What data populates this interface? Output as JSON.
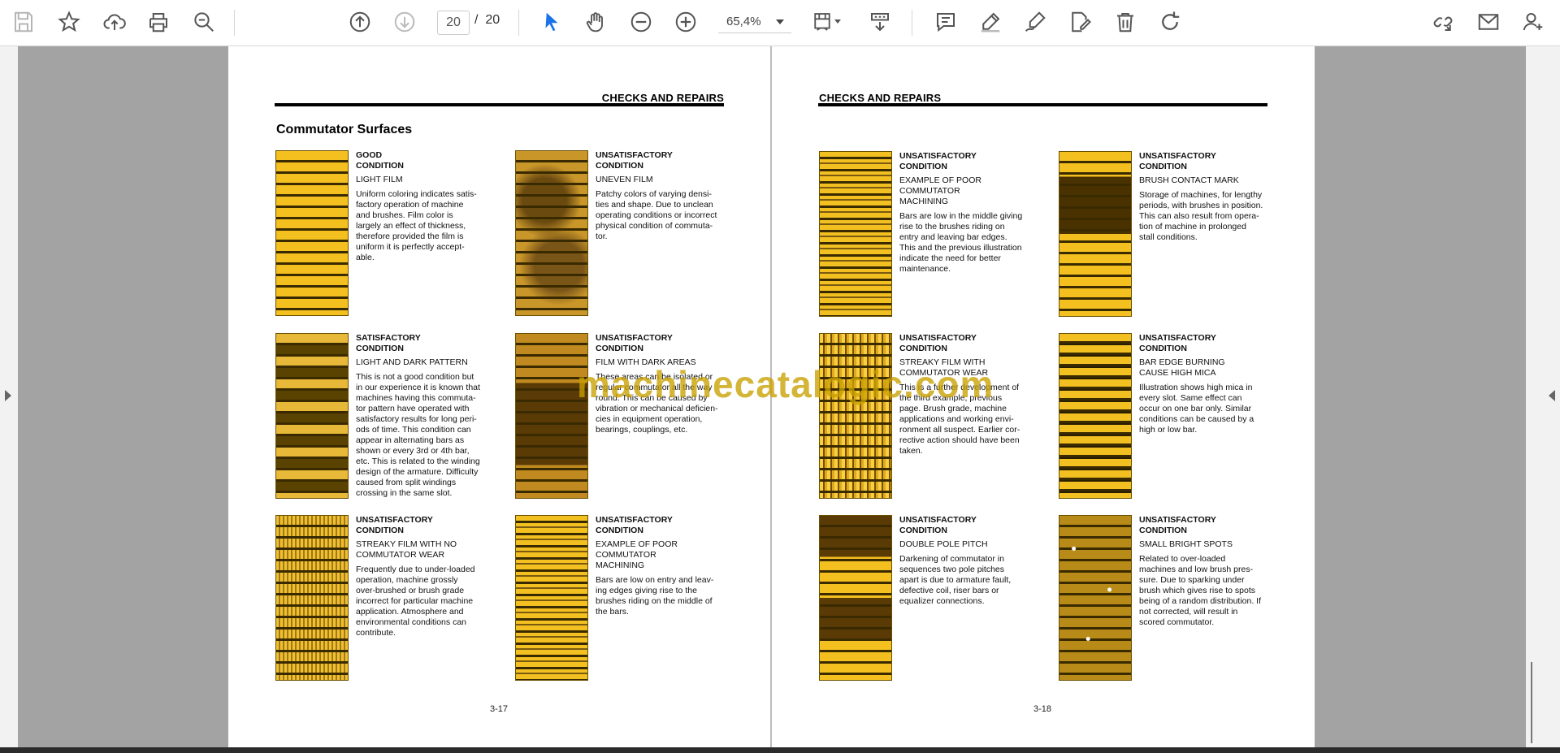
{
  "toolbar": {
    "page_current": "20",
    "page_separator": "/",
    "page_total": "20",
    "zoom": "65,4%",
    "icons": [
      "save-icon",
      "bookmark-star-icon",
      "cloud-upload-icon",
      "print-icon",
      "zoom-search-icon",
      "page-up-icon",
      "page-down-icon",
      "select-arrow-icon",
      "hand-tool-icon",
      "zoom-out-icon",
      "zoom-in-icon",
      "fit-page-icon",
      "scroll-mode-icon",
      "comment-icon",
      "highlight-pen-icon",
      "sign-pen-icon",
      "edit-document-icon",
      "delete-icon",
      "rotate-icon",
      "share-link-icon",
      "email-icon",
      "add-user-icon"
    ]
  },
  "left_page": {
    "header": "CHECKS AND REPAIRS",
    "title": "Commutator Surfaces",
    "page_number": "3-17",
    "entries": [
      {
        "condition": "GOOD\nCONDITION",
        "subtitle": "LIGHT FILM",
        "description": "Uniform coloring indicates satis-\nfactory operation of machine\nand brushes. Film color is\nlargely an effect of thickness,\ntherefore provided the film is\nuniform it is perfectly accept-\nable."
      },
      {
        "condition": "UNSATISFACTORY\nCONDITION",
        "subtitle": "UNEVEN FILM",
        "description": "Patchy colors of varying densi-\nties and shape. Due to unclean\noperating conditions or incorrect\nphysical condition of commuta-\ntor."
      },
      {
        "condition": "SATISFACTORY\nCONDITION",
        "subtitle": "LIGHT AND DARK PATTERN",
        "description": "This is not a good condition but\nin our experience it is known that\nmachines having this commuta-\ntor pattern have operated with\nsatisfactory results for long peri-\nods of time. This condition can\nappear in alternating bars as\nshown or every 3rd or 4th bar,\netc. This is related to the winding\ndesign of the armature. Difficulty\ncaused from split windings\ncrossing in the same slot."
      },
      {
        "condition": "UNSATISFACTORY\nCONDITION",
        "subtitle": "FILM WITH DARK AREAS",
        "description": "These areas can be isolated or\nregular commutator all the way\nround. This can be caused by\nvibration or mechanical deficien-\ncies in equipment operation,\nbearings, couplings, etc."
      },
      {
        "condition": "UNSATISFACTORY\nCONDITION",
        "subtitle": "STREAKY FILM WITH NO\nCOMMUTATOR WEAR",
        "description": "Frequently due to under-loaded\noperation, machine grossly\nover-brushed or brush grade\nincorrect for particular machine\napplication. Atmosphere and\nenvironmental conditions can\ncontribute."
      },
      {
        "condition": "UNSATISFACTORY\nCONDITION",
        "subtitle": "EXAMPLE OF POOR\nCOMMUTATOR\nMACHINING",
        "description": "Bars are low on entry and leav-\ning edges giving rise to the\nbrushes riding on the middle of\nthe bars."
      }
    ]
  },
  "right_page": {
    "header": "CHECKS AND REPAIRS",
    "page_number": "3-18",
    "entries": [
      {
        "condition": "UNSATISFACTORY\nCONDITION",
        "subtitle": "EXAMPLE OF POOR\nCOMMUTATOR\nMACHINING",
        "description": "Bars are low in the middle giving\nrise to the brushes riding on\nentry and leaving bar edges.\nThis and the previous illustration\nindicate the need for better\nmaintenance."
      },
      {
        "condition": "UNSATISFACTORY\nCONDITION",
        "subtitle": "BRUSH CONTACT MARK",
        "description": "Storage of machines, for lengthy\nperiods, with brushes in position.\nThis can also result from opera-\ntion of machine in prolonged\nstall conditions."
      },
      {
        "condition": "UNSATISFACTORY\nCONDITION",
        "subtitle": "STREAKY FILM WITH\nCOMMUTATOR WEAR",
        "description": "This is a further development of\nthe third example, previous\npage. Brush grade, machine\napplications and working envi-\nronment all suspect. Earlier cor-\nrective action should have been\ntaken."
      },
      {
        "condition": "UNSATISFACTORY\nCONDITION",
        "subtitle": "BAR EDGE BURNING\nCAUSE HIGH MICA",
        "description": "Illustration shows high mica in\nevery slot. Same effect can\noccur on one bar only. Similar\nconditions can be caused by a\nhigh or low bar."
      },
      {
        "condition": "UNSATISFACTORY\nCONDITION",
        "subtitle": "DOUBLE POLE PITCH",
        "description": "Darkening of commutator in\nsequences two pole pitches\napart is due to armature fault,\ndefective coil, riser bars or\nequalizer connections."
      },
      {
        "condition": "UNSATISFACTORY\nCONDITION",
        "subtitle": "SMALL BRIGHT SPOTS",
        "description": "Related to over-loaded\nmachines and low brush pres-\nsure. Due to sparking under\nbrush which gives rise to spots\nbeing of a random distribution. If\nnot corrected, will result in\nscored commutator."
      }
    ]
  },
  "watermark": "machinecatalogic.com",
  "colors": {
    "accent": "#1a73e8",
    "film_light": "#f4c020",
    "film_dark": "#5a3c00"
  }
}
